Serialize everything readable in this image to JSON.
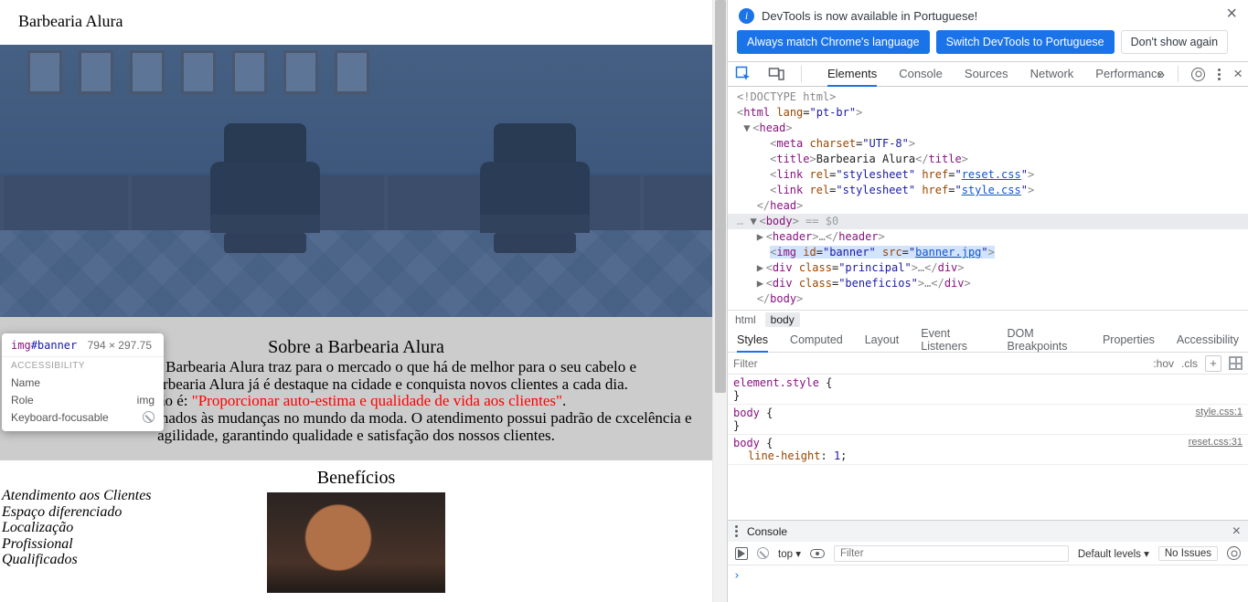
{
  "infobar": {
    "text": "DevTools is now available in Portuguese!"
  },
  "chips": {
    "match": "Always match Chrome's language",
    "switch": "Switch DevTools to Portuguese",
    "dont": "Don't show again"
  },
  "tabs": {
    "elements": "Elements",
    "console": "Console",
    "sources": "Sources",
    "network": "Network",
    "performance": "Performance"
  },
  "breadcrumb": {
    "a": "html",
    "b": "body"
  },
  "styleTabs": {
    "styles": "Styles",
    "computed": "Computed",
    "layout": "Layout",
    "events": "Event Listeners",
    "dombp": "DOM Breakpoints",
    "props": "Properties",
    "a11y": "Accessibility"
  },
  "filter": {
    "placeholder": "Filter",
    "hov": ":hov",
    "cls": ".cls"
  },
  "rules": {
    "r0": {
      "sel": "element.style",
      "open": " {",
      "close": "}"
    },
    "r1": {
      "sel": "body",
      "open": " {",
      "close": "}",
      "src": "style.css:1"
    },
    "r2": {
      "sel": "body",
      "open": " {",
      "close": "}",
      "src": "reset.css:31",
      "decl_prop": "line-height",
      "decl_val": "1"
    }
  },
  "drawer": {
    "title": "Console",
    "top": "top",
    "filterPh": "Filter",
    "levels": "Default levels",
    "noissues": "No Issues"
  },
  "page": {
    "header": "Barbearia Alura",
    "about": {
      "title": "Sobre a Barbearia Alura",
      "p1a": "io da cidade a Barbearia Alura traz para o mercado o que há de melhor para o seu cabelo e",
      "missao": "ssão é:",
      "p2": " n 2019, a Barbearia Alura já é destaque na cidade e conquista novos clientes a cada dia.",
      "quote": " \"Proporcionar auto-estima e qualidade de vida aos clientes\"",
      "period": ".",
      "p3": "hais experientes e antenados às mudanças no mundo da moda. O atendimento possui padrão de cxcelência e agilidade, garantindo qualidade e satisfação dos nossos clientes."
    },
    "benefits": {
      "title": "Benefícios",
      "items": {
        "i0": "Atendimento aos Clientes",
        "i1": "Espaço diferenciado",
        "i2": "Localização",
        "i3": "Profissional",
        "i4": "Qualificados"
      }
    }
  },
  "tooltip": {
    "tag": "img",
    "id": "#banner",
    "dim": "794 × 297.75",
    "section": "ACCESSIBILITY",
    "rows": {
      "name": "Name",
      "role": "Role",
      "roleVal": "img",
      "kf": "Keyboard-focusable"
    }
  },
  "tree": {
    "doctype": "<!DOCTYPE html>",
    "htmlOpen_a": "<",
    "htmlOpen_tag": "html",
    "htmlOpen_attrn": " lang",
    "htmlOpen_eq": "=",
    "htmlOpen_attrv": "\"pt-br\"",
    "htmlOpen_b": ">",
    "headOpen": "<head>",
    "meta_a": "<",
    "meta_tag": "meta",
    "meta_attrn": " charset",
    "meta_attrv": "\"UTF-8\"",
    "meta_b": ">",
    "title_open": "<",
    "title_tag": "title",
    "title_gt": ">",
    "title_txt": "Barbearia Alura",
    "title_close": "</title>",
    "link1_a": "<",
    "link1_tag": "link",
    "link1_rel": " rel",
    "link1_relv": "\"stylesheet\"",
    "link1_href": " href",
    "link1_hrefv": "reset.css",
    "link1_b": ">",
    "link2_a": "<",
    "link2_tag": "link",
    "link2_rel": " rel",
    "link2_relv": "\"stylesheet\"",
    "link2_href": " href",
    "link2_hrefv": "style.css",
    "link2_b": ">",
    "headClose": "</head>",
    "bodyOpen": "<body>",
    "bodyDollar": " == $0",
    "headerLine_open": "<",
    "headerLine_tag": "header",
    "headerLine_mid": ">…</",
    "headerLine_tag2": "header",
    "headerLine_end": ">",
    "imgLine_open": "<",
    "imgLine_tag": "img",
    "imgLine_idN": " id",
    "imgLine_idV": "\"banner\"",
    "imgLine_srcN": " src",
    "imgLine_srcV": "banner.jpg",
    "imgLine_end": ">",
    "div1_open": "<",
    "div1_tag": "div",
    "div1_clsN": " class",
    "div1_clsV": "\"principal\"",
    "div1_mid": ">…</",
    "div1_tag2": "div",
    "div1_end": ">",
    "div2_open": "<",
    "div2_tag": "div",
    "div2_clsN": " class",
    "div2_clsV": "\"beneficios\"",
    "div2_mid": ">…</",
    "div2_tag2": "div",
    "div2_end": ">",
    "bodyClose": "</body>"
  }
}
